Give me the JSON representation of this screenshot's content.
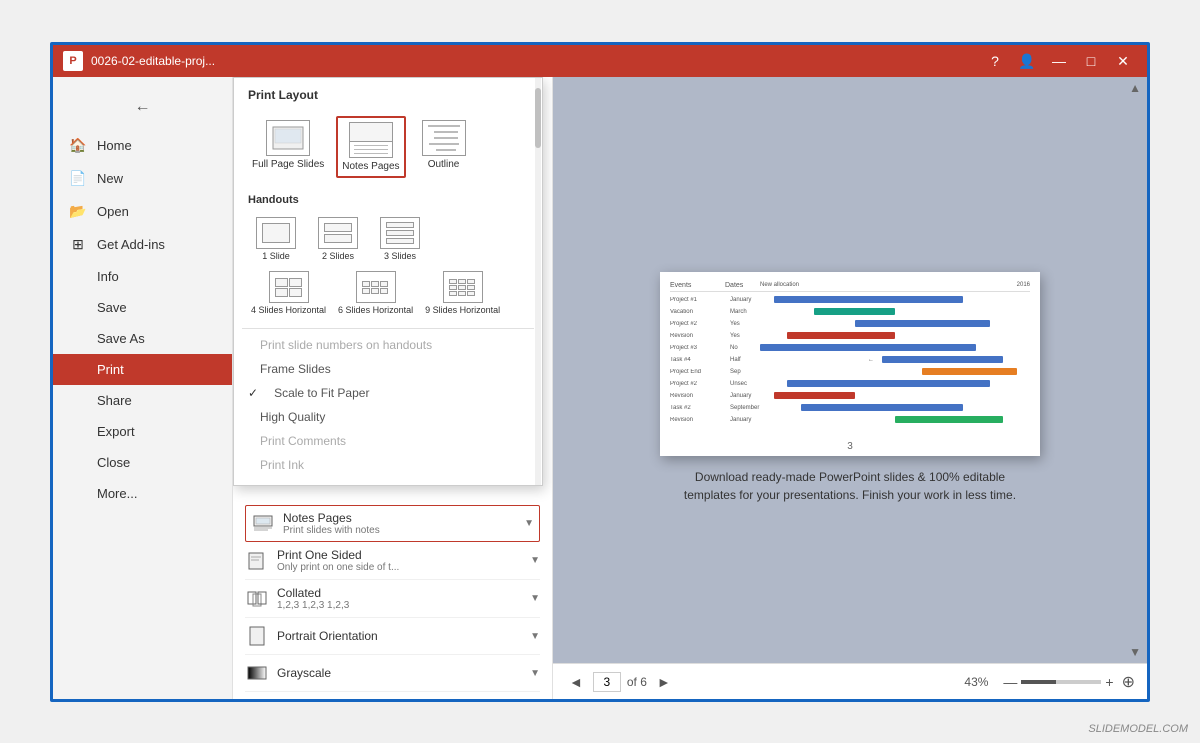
{
  "window": {
    "title": "0026-02-editable-proj...",
    "logo": "P"
  },
  "titlebar": {
    "controls": [
      "?",
      "—",
      "□",
      "✕"
    ]
  },
  "sidebar": {
    "items": [
      {
        "label": "Home",
        "icon": "🏠"
      },
      {
        "label": "New",
        "icon": "📄"
      },
      {
        "label": "Open",
        "icon": "📂"
      },
      {
        "label": "Get Add-ins",
        "icon": "⊞"
      },
      {
        "label": "Info",
        "icon": ""
      },
      {
        "label": "Save",
        "icon": ""
      },
      {
        "label": "Save As",
        "icon": ""
      },
      {
        "label": "Print",
        "icon": ""
      },
      {
        "label": "Share",
        "icon": ""
      },
      {
        "label": "Export",
        "icon": ""
      },
      {
        "label": "Close",
        "icon": ""
      },
      {
        "label": "More...",
        "icon": ""
      }
    ]
  },
  "popup": {
    "header": "Print Layout",
    "layouts": [
      {
        "label": "Full Page Slides",
        "type": "full"
      },
      {
        "label": "Notes Pages",
        "type": "notes",
        "selected": true
      },
      {
        "label": "Outline",
        "type": "outline"
      }
    ],
    "handouts_section": "Handouts",
    "handouts": [
      {
        "label": "1 Slide"
      },
      {
        "label": "2 Slides"
      },
      {
        "label": "3 Slides"
      },
      {
        "label": "4 Slides Horizontal"
      },
      {
        "label": "6 Slides Horizontal"
      },
      {
        "label": "9 Slides Horizontal"
      }
    ],
    "options": [
      {
        "label": "Print slide numbers on handouts",
        "checked": false,
        "greyed": true
      },
      {
        "label": "Frame Slides",
        "checked": false
      },
      {
        "label": "Scale to Fit Paper",
        "checked": true
      },
      {
        "label": "High Quality",
        "checked": false
      },
      {
        "label": "Print Comments",
        "checked": false,
        "greyed": true
      },
      {
        "label": "Print Ink",
        "checked": false,
        "greyed": true
      }
    ]
  },
  "print_settings": [
    {
      "title": "Notes Pages",
      "subtitle": "Print slides with notes",
      "icon": "notes",
      "active": true
    },
    {
      "title": "Print One Sided",
      "subtitle": "Only print on one side of t...",
      "icon": "onesided"
    },
    {
      "title": "Collated",
      "subtitle": "1,2,3   1,2,3   1,2,3",
      "icon": "collated"
    },
    {
      "title": "Portrait Orientation",
      "subtitle": "",
      "icon": "portrait"
    },
    {
      "title": "Grayscale",
      "subtitle": "",
      "icon": "grayscale"
    }
  ],
  "preview": {
    "description": "Download ready-made PowerPoint slides & 100% editable templates for your presentations. Finish your work in less time.",
    "page_current": "3",
    "page_total": "6",
    "zoom_level": "43%"
  },
  "watermark": "SLIDEMODEL.COM"
}
